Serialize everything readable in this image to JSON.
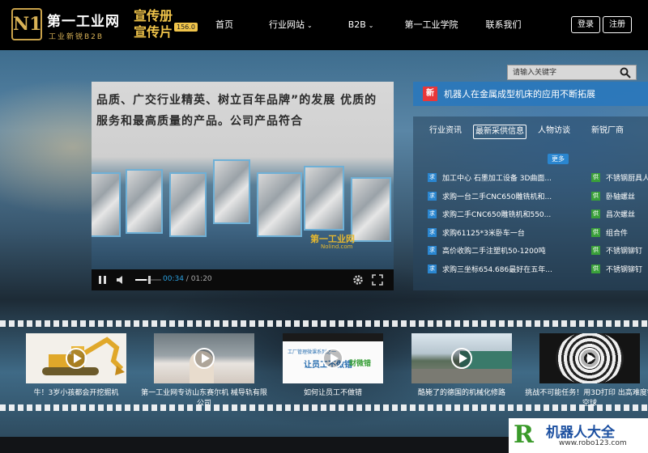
{
  "brand": {
    "logo_mark": "N1",
    "name": "第一工业网",
    "slogan": "工业新锐B2B",
    "promo_text": "宣传册 宣传片",
    "promo_badge": "156.0"
  },
  "nav": {
    "items": [
      {
        "label": "首页",
        "dropdown": false
      },
      {
        "label": "行业网站",
        "dropdown": true
      },
      {
        "label": "B2B",
        "dropdown": true
      },
      {
        "label": "第一工业学院",
        "dropdown": false
      },
      {
        "label": "联系我们",
        "dropdown": false
      }
    ],
    "login": "登录",
    "register": "注册"
  },
  "search": {
    "placeholder": "请输入关键字"
  },
  "video": {
    "caption": "品质、广交行业精英、树立百年品牌”的发展 优质的服务和最高质量的产品。公司产品符合",
    "watermark": "第一工业网",
    "watermark_sub": "Nolind.com",
    "current_time": "00:34",
    "duration": "01:20",
    "progress": 0.425
  },
  "headline": {
    "badge": "新",
    "text": "机器人在金属成型机床的应用不断拓展"
  },
  "news": {
    "tabs": [
      "行业资讯",
      "最新采供信息",
      "人物访谈",
      "新锐厂商"
    ],
    "active_tab": 1,
    "more": "更多",
    "purchase_tag": "求",
    "supply_tag": "供",
    "purchase": [
      "加工中心 石墨加工设备 3D曲面...",
      "求购一台二手CNC650雕铣机和...",
      "求购二手CNC650雕铣机和550...",
      "求购61125*3米卧车一台",
      "高价收购二手注塑机50-1200吨",
      "求购三坐标654.686最好在五年..."
    ],
    "supply": [
      "不锈钢厨具人",
      "卧轴螺丝",
      "昌次螺丝",
      "组合件",
      "不锈钢铆钉",
      "不锈钢铆钉"
    ]
  },
  "videos": [
    {
      "caption": "牛！3岁小孩都会开挖掘机",
      "thumb": "excavator"
    },
    {
      "caption": "第一工业网专访山东赛尔机 械导轨有限公司",
      "thumb": "interview"
    },
    {
      "caption": "如何让员工不做错",
      "thumb": "slide"
    },
    {
      "caption": "酷毙了的德国的机械化修路",
      "thumb": "road"
    },
    {
      "caption": "挑战不可能任务！用3D打印 出高难度镂空球",
      "thumb": "sphere"
    }
  ],
  "slide_thumb": {
    "title": "工厂管理微课系列之一",
    "line": "让员工不做错",
    "sub": "财微错"
  },
  "footer_badge": {
    "title": "机器人大全",
    "url": "www.robo123.com",
    "mark": "R"
  },
  "colors": {
    "accent": "#2a86d0",
    "headline_bg": "#2878be",
    "gold": "#d9b256",
    "new_badge": "#e8373a"
  }
}
